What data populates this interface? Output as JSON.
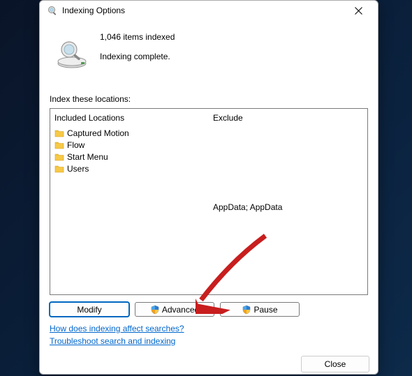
{
  "title": "Indexing Options",
  "status": {
    "count_line": "1,046 items indexed",
    "state_line": "Indexing complete."
  },
  "locations_label": "Index these locations:",
  "columns": {
    "included_header": "Included Locations",
    "exclude_header": "Exclude"
  },
  "included": [
    {
      "name": "Captured Motion",
      "exclude": ""
    },
    {
      "name": "Flow",
      "exclude": ""
    },
    {
      "name": "Start Menu",
      "exclude": ""
    },
    {
      "name": "Users",
      "exclude": "AppData; AppData"
    }
  ],
  "buttons": {
    "modify": "Modify",
    "advanced": "Advanced",
    "pause": "Pause",
    "close": "Close"
  },
  "links": {
    "help": "How does indexing affect searches?",
    "troubleshoot": "Troubleshoot search and indexing"
  }
}
